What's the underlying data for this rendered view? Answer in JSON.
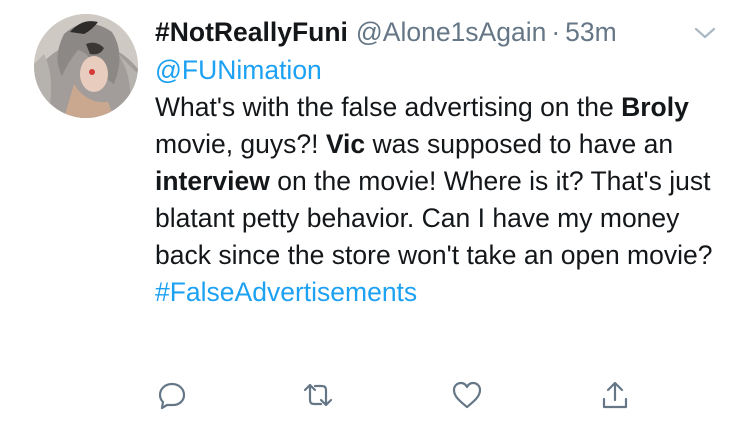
{
  "tweet": {
    "display_name": "#NotReallyFuni",
    "handle": "@Alone1sAgain",
    "separator": "·",
    "time": "53m",
    "reply_to": "@FUNimation",
    "segments": [
      {
        "text": "What's with the false advertising on the ",
        "bold": false
      },
      {
        "text": "Broly",
        "bold": true
      },
      {
        "text": " movie, guys?! ",
        "bold": false
      },
      {
        "text": "Vic",
        "bold": true
      },
      {
        "text": " was supposed to have an ",
        "bold": false
      },
      {
        "text": "interview",
        "bold": true
      },
      {
        "text": " on the movie! Where is it? That's just blatant petty behavior. Can I have my money back since the store won't take an open movie?",
        "bold": false
      }
    ],
    "hashtag": "#FalseAdvertisements"
  },
  "icons": {
    "reply": "reply-icon",
    "retweet": "retweet-icon",
    "like": "heart-icon",
    "share": "share-icon",
    "menu": "chevron-down-icon"
  },
  "colors": {
    "link": "#1da1f2",
    "muted": "#657786",
    "text": "#14171a"
  }
}
